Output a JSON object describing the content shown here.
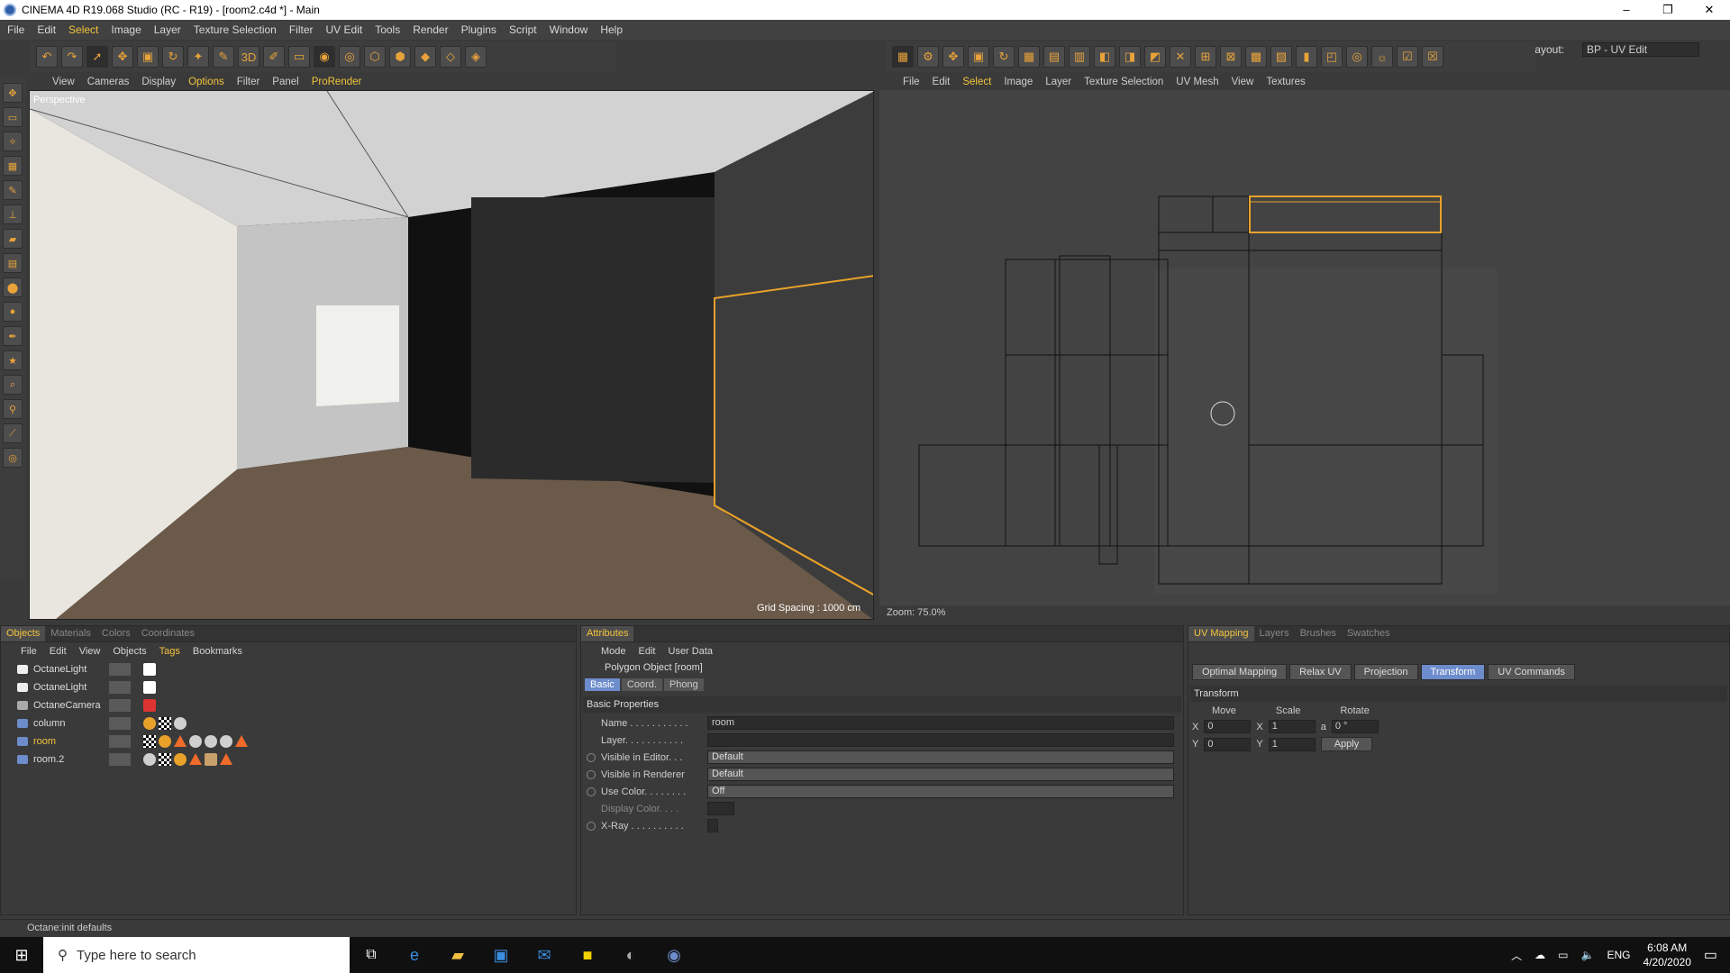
{
  "window": {
    "title": "CINEMA 4D R19.068 Studio (RC - R19) - [room2.c4d *] - Main",
    "minimize": "–",
    "maximize": "❐",
    "close": "✕"
  },
  "menubar": {
    "items": [
      "File",
      "Edit",
      "Select",
      "Image",
      "Layer",
      "Texture Selection",
      "Filter",
      "UV Edit",
      "Tools",
      "Render",
      "Plugins",
      "Script",
      "Window",
      "Help"
    ],
    "layout_label": "Layout:",
    "layout_value": "BP - UV Edit"
  },
  "viewport_menu": {
    "items": [
      "View",
      "Cameras",
      "Display",
      "Options",
      "Filter",
      "Panel",
      "ProRender"
    ]
  },
  "viewport": {
    "label": "Perspective",
    "grid_spacing": "Grid Spacing : 1000 cm"
  },
  "uv_menu": {
    "items": [
      "File",
      "Edit",
      "Select",
      "Image",
      "Layer",
      "Texture Selection",
      "UV Mesh",
      "View",
      "Textures"
    ]
  },
  "uv": {
    "zoom": "Zoom: 75.0%"
  },
  "objects_panel": {
    "tabs": [
      "Objects",
      "Materials",
      "Colors",
      "Coordinates"
    ],
    "menu": [
      "File",
      "Edit",
      "View",
      "Objects",
      "Tags",
      "Bookmarks"
    ],
    "rows": [
      {
        "name": "OctaneLight"
      },
      {
        "name": "OctaneLight"
      },
      {
        "name": "OctaneCamera"
      },
      {
        "name": "column"
      },
      {
        "name": "room"
      },
      {
        "name": "room.2"
      }
    ]
  },
  "attributes_panel": {
    "tab": "Attributes",
    "menu": [
      "Mode",
      "Edit",
      "User Data"
    ],
    "object": "Polygon Object [room]",
    "subtabs": [
      "Basic",
      "Coord.",
      "Phong"
    ],
    "section": "Basic Properties",
    "props": [
      {
        "label": "Name . . . . . . . . . . .",
        "value": "room"
      },
      {
        "label": "Layer. . . . . . . . . . .",
        "value": ""
      },
      {
        "label": "Visible in Editor. . .",
        "value": "Default"
      },
      {
        "label": "Visible in Renderer",
        "value": "Default"
      },
      {
        "label": "Use Color. . . . . . . .",
        "value": "Off"
      },
      {
        "label": "Display Color. . . .",
        "value": ""
      },
      {
        "label": "X-Ray . . . . . . . . . .",
        "value": ""
      }
    ]
  },
  "uv_panel": {
    "tabs": [
      "UV Mapping",
      "Layers",
      "Brushes",
      "Swatches"
    ],
    "buttons": [
      "Optimal Mapping",
      "Relax UV",
      "Projection",
      "Transform",
      "UV Commands"
    ],
    "section": "Transform",
    "headers": [
      "Move",
      "Scale",
      "Rotate"
    ],
    "x": {
      "move": "0",
      "scale": "1",
      "rotate": "0 °"
    },
    "y": {
      "move": "0",
      "scale": "1"
    },
    "axis_x": "X",
    "axis_y": "Y",
    "axis_a": "a",
    "apply": "Apply"
  },
  "status": "Octane:init defaults",
  "taskbar": {
    "search": "Type here to search",
    "lang": "ENG",
    "time": "6:08 AM",
    "date": "4/20/2020"
  }
}
